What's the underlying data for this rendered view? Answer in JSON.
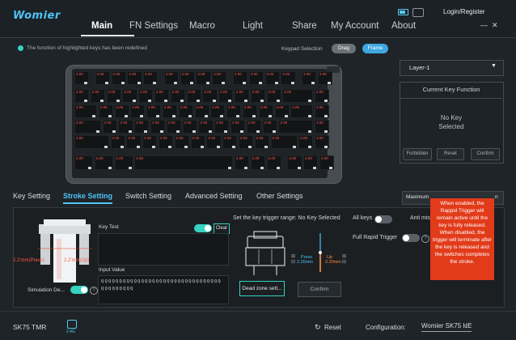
{
  "app": {
    "logo": "Womier",
    "login": "Login/Register"
  },
  "nav": [
    "Main",
    "FN Settings",
    "Macro",
    "Light",
    "Share",
    "My Account",
    "About"
  ],
  "status": {
    "notice": "The function of highlighted keys has been redefined"
  },
  "keypad": {
    "label": "Keypad Selection",
    "options": [
      "Drag",
      "Frame"
    ],
    "selected": "Frame"
  },
  "layer": {
    "selected": "Layer-1"
  },
  "current_key": {
    "title": "Current Key Function",
    "empty": "No Key Selected",
    "buttons": [
      "Forbidden",
      "Reset",
      "Confirm"
    ]
  },
  "keyboard": {
    "key_value": "2.00"
  },
  "subtabs": [
    "Key Setting",
    "Stroke Setting",
    "Switch Setting",
    "Advanced Setting",
    "Other Settings"
  ],
  "maximum": {
    "label": "Maximum",
    "tail": "n"
  },
  "stroke": {
    "press_dim": "2.2'mm(Press)",
    "up_dim": "2.2'mm(Up)",
    "simulation_label": "Simulation De...",
    "key_test_label": "Key Test",
    "clear_label": "Clear",
    "input_value_label": "Input Value",
    "input_value_text": "QQQQQQQQQQQQQQQQQQQQQQQQQQQQQQQQQQQQQQQQQQ",
    "trigger_range_label": "Set the key trigger range: No Key Selected",
    "press_label": "Press",
    "press_value": "2.20mm",
    "up_label": "Up",
    "up_value": "2.20mm",
    "deadzone_btn": "Dead zone sett...",
    "confirm_btn": "Confirm",
    "all_keys": "All keys",
    "anti_misop": "Anti misoper",
    "full_rapid": "Full Rapid Trigger",
    "tooltip": "When enabled, the Rappid Trigger will remain active until the key is fully released. When disabled, the trigger will terminate after the key is released and the switches completes the stroke."
  },
  "footer": {
    "model": "SK75 TMR",
    "connection": "2.4G",
    "reset": "Reset",
    "config_label": "Configuration:",
    "config_value": "Womier SK75 HE"
  },
  "colors": {
    "accent": "#4fc3f7",
    "teal": "#35d3c1",
    "alert": "#e23b1a",
    "key_label": "#ff5a4e"
  }
}
